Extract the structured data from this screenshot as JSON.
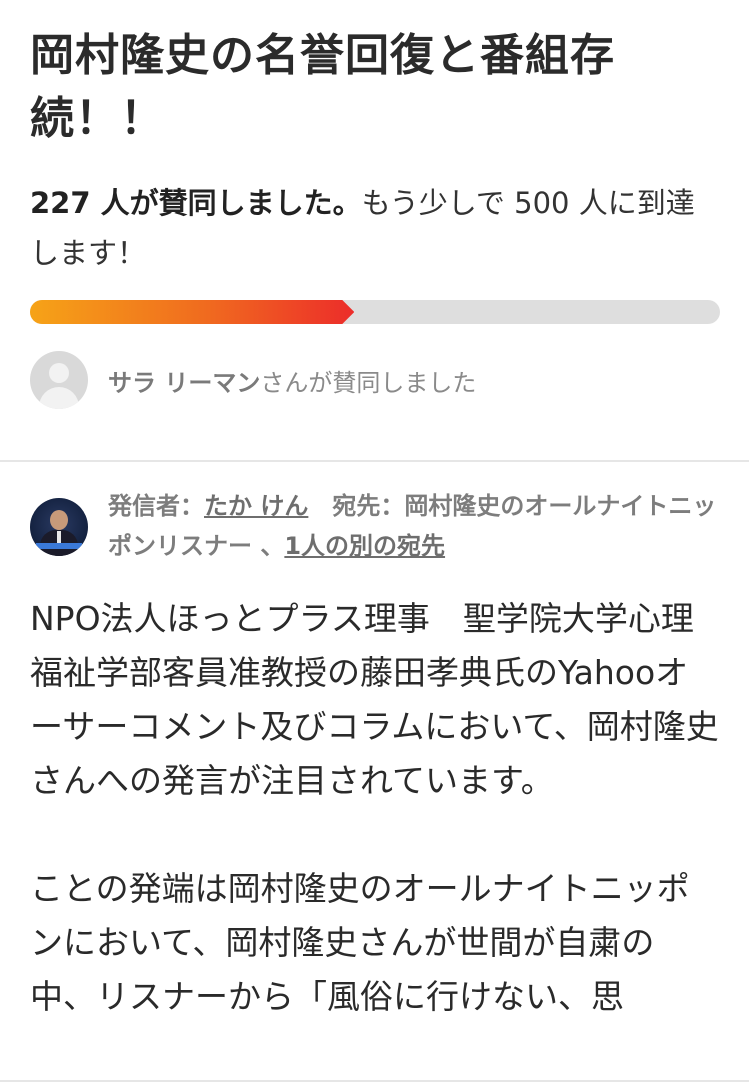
{
  "petition": {
    "title": "岡村隆史の名誉回復と番組存続！！",
    "supporters_bold": "227 人が賛同しました。",
    "supporters_rest": "もう少しで 500 人に到達します！",
    "supporters_count": 227,
    "goal": 500,
    "progress_fraction": 0.47,
    "progress_colors": [
      "#f6a317",
      "#ec2d2a"
    ]
  },
  "recent_signer": {
    "name": "サラ リーマン",
    "suffix": "さんが賛同しました",
    "avatar": "default-user-icon"
  },
  "author": {
    "from_label": "発信者：",
    "from_name": "たか けん",
    "to_label": "宛先：",
    "to_name": "岡村隆史のオールナイトニッポンリスナー",
    "separator": "、",
    "other_recipients": "1人の別の宛先"
  },
  "body": {
    "paragraphs": [
      "NPO法人ほっとプラス理事　聖学院大学心理福祉学部客員准教授の藤田孝典氏のYahooオーサーコメント及びコラムにおいて、岡村隆史さんへの発言が注目されています。",
      "ことの発端は岡村隆史のオールナイトニッポンにおいて、岡村隆史さんが世間が自粛の中、リスナーから「風俗に行けない、思"
    ]
  }
}
